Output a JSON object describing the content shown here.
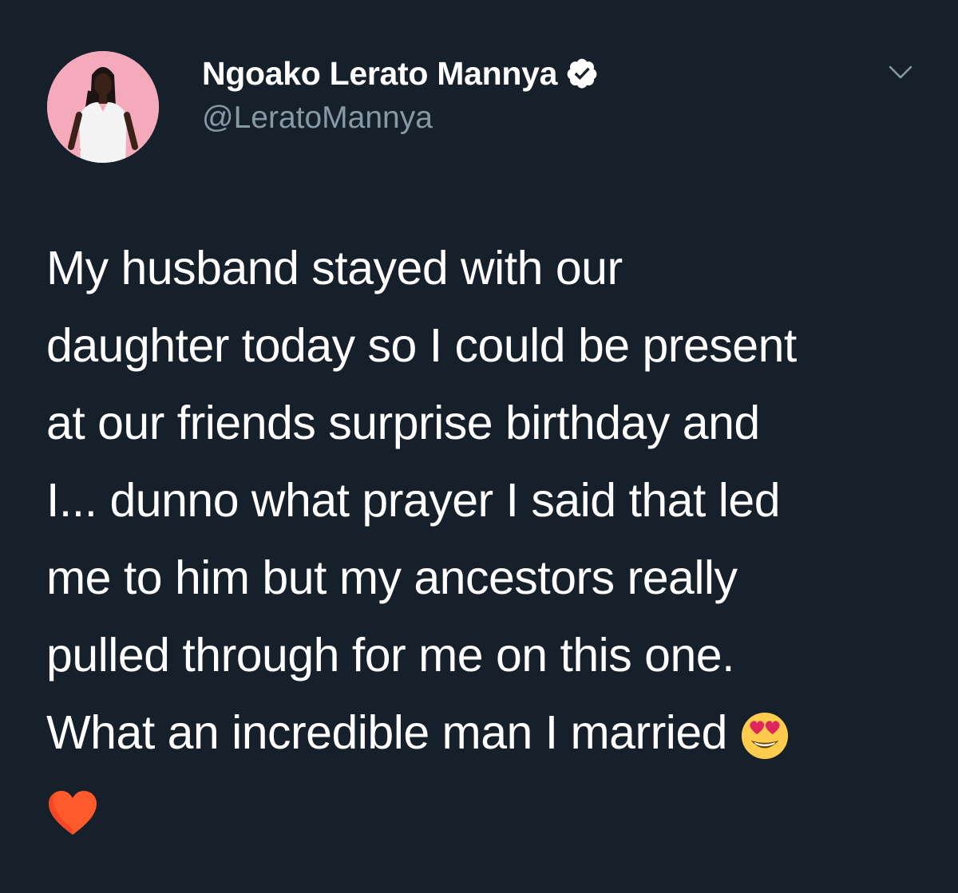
{
  "author": {
    "display_name": "Ngoako Lerato Mannya",
    "handle": "@LeratoMannya",
    "verified": true
  },
  "tweet": {
    "lines": [
      "My husband stayed with our",
      "daughter today so I could be present",
      "at our friends surprise birthday and",
      "I... dunno what prayer I said that led",
      "me to him but my ancestors really",
      "pulled through for me on this one.",
      "What an incredible man I married"
    ],
    "emojis": [
      "heart-eyes-emoji",
      "red-heart-emoji"
    ]
  },
  "icons": {
    "verified": "verified-badge-icon",
    "menu": "chevron-down-icon"
  },
  "colors": {
    "background": "#15202b",
    "primary_text": "#ffffff",
    "secondary_text": "#8899a6"
  }
}
